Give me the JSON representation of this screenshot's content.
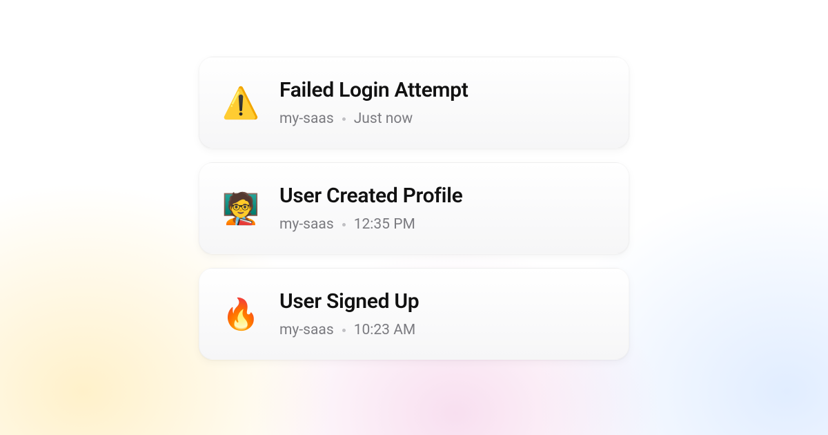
{
  "events": [
    {
      "emoji": "⚠️",
      "icon_name": "warning-icon",
      "title": "Failed Login Attempt",
      "source": "my-saas",
      "time": "Just now"
    },
    {
      "emoji": "🧑‍🏫",
      "icon_name": "teacher-icon",
      "title": "User Created Profile",
      "source": "my-saas",
      "time": "12:35 PM"
    },
    {
      "emoji": "🔥",
      "icon_name": "fire-icon",
      "title": "User Signed Up",
      "source": "my-saas",
      "time": "10:23 AM"
    }
  ]
}
